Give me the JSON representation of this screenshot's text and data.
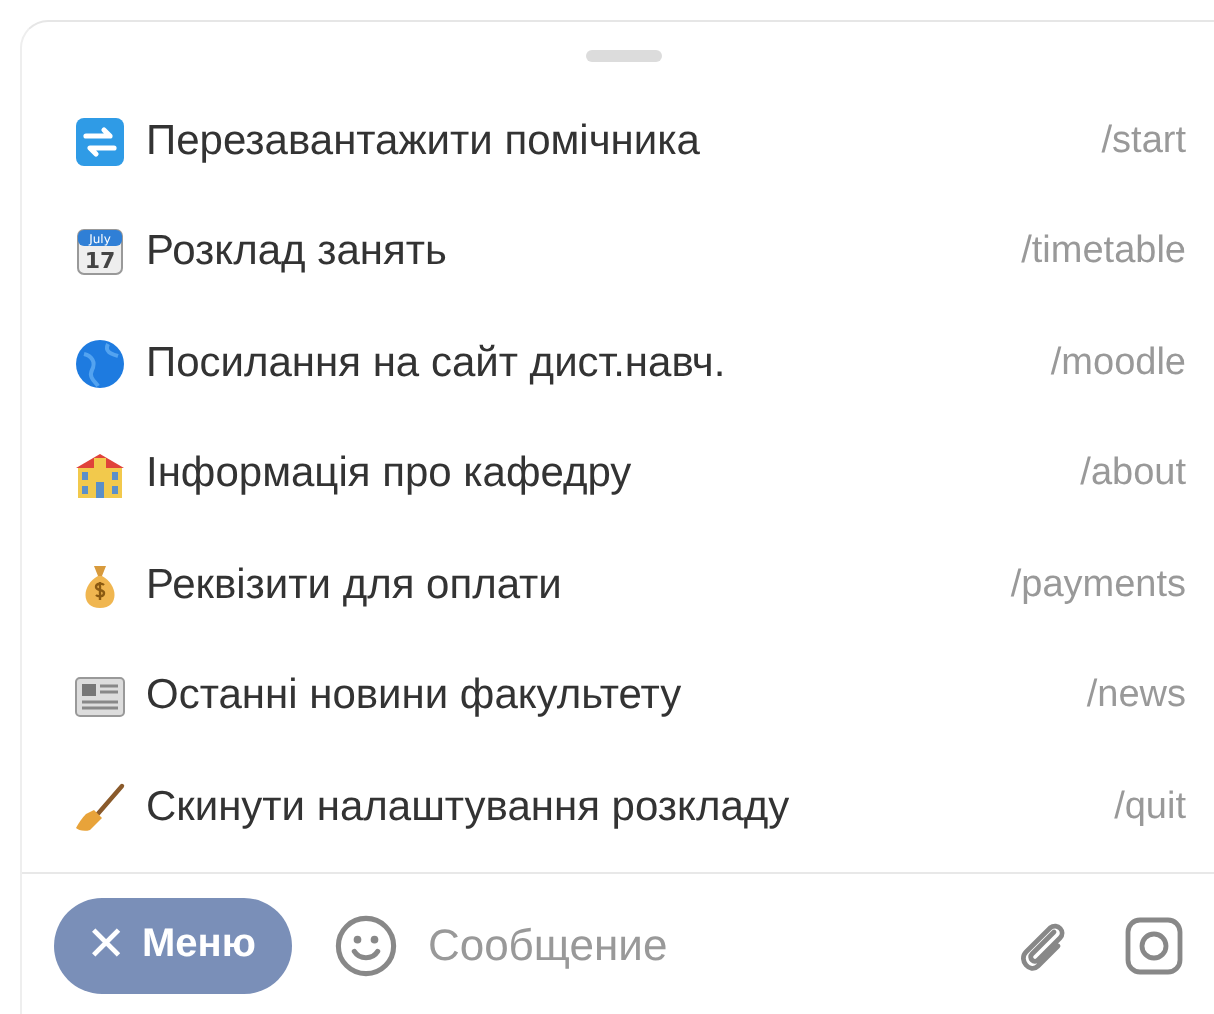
{
  "commands": [
    {
      "label": "Перезавантажити помічника",
      "command": "/start"
    },
    {
      "label": "Розклад занять",
      "command": "/timetable"
    },
    {
      "label": "Посилання на сайт дист.навч.",
      "command": "/moodle"
    },
    {
      "label": "Інформація про кафедру",
      "command": "/about"
    },
    {
      "label": "Реквізити для оплати",
      "command": "/payments"
    },
    {
      "label": "Останні новини факультету",
      "command": "/news"
    },
    {
      "label": "Скинути налаштування розкладу",
      "command": "/quit"
    }
  ],
  "calendar_icon_text": {
    "month": "July",
    "day": "17"
  },
  "input_bar": {
    "menu_button": {
      "icon": "✕",
      "label": "Меню"
    },
    "message": {
      "placeholder": "Сообщение"
    }
  }
}
